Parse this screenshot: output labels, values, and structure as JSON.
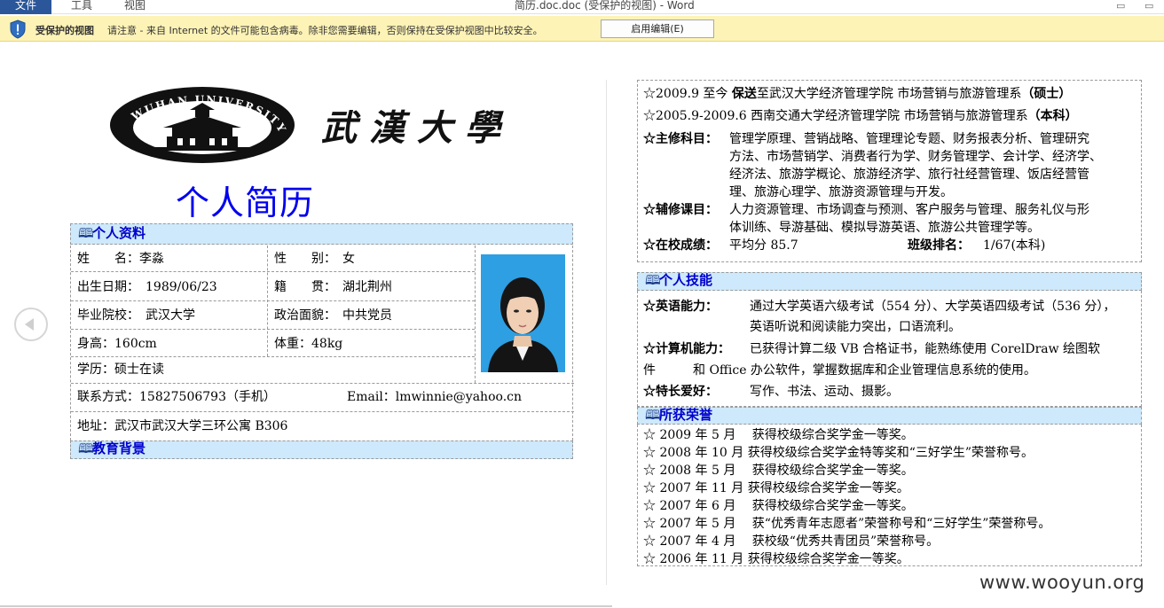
{
  "ribbon": {
    "file_tab": "文件",
    "tools_tab": "工具",
    "view_tab": "视图",
    "window_title": "简历.doc.doc (受保护的视图) - Word"
  },
  "protected_bar": {
    "title": "受保护的视图",
    "message": "请注意 - 来自 Internet 的文件可能包含病毒。除非您需要编辑，否则保持在受保护视图中比较安全。",
    "enable_button": "启用编辑(E)"
  },
  "left_page": {
    "logo_text": "WUHAN UNIVERSITY",
    "calligraphy": "武漢大學",
    "resume_title": "个人简历",
    "personal_section": "个人资料",
    "education_section": "教育背景",
    "info": {
      "name": "姓　　名：李淼",
      "gender": "性　　别：　女",
      "birth": "出生日期：　1989/06/23",
      "native": "籍　　贯：　湖北荆州",
      "school": "毕业院校：　武汉大学",
      "politics": "政治面貌：　中共党员",
      "height": "身高：160cm",
      "weight": "体重：48kg",
      "degree": "学历：硕士在读",
      "contact": "联系方式：15827506793（手机）",
      "email": "Email：lmwinnie@yahoo.cn",
      "address": "地址：武汉市武汉大学三环公寓 B306"
    }
  },
  "right_page": {
    "edu1_prefix": "☆2009.9 至今",
    "edu1_bold": "保送",
    "edu1_rest": "至武汉大学经济管理学院 市场营销与旅游管理系",
    "edu1_degree": "（硕士）",
    "edu2_text": "☆2005.9-2009.6 西南交通大学经济管理学院 市场营销与旅游管理系",
    "edu2_degree": "（本科）",
    "major_label": "☆主修科目：",
    "major_lines": [
      "管理学原理、营销战略、管理理论专题、财务报表分析、管理研究",
      "方法、市场营销学、消费者行为学、财务管理学、会计学、经济学、",
      "经济法、旅游学概论、旅游经济学、旅行社经营管理、饭店经营管",
      "理、旅游心理学、旅游资源管理与开发。"
    ],
    "minor_label": "☆辅修课目：",
    "minor_lines": [
      "人力资源管理、市场调查与预测、客户服务与管理、服务礼仪与形",
      "体训练、导游基础、模拟导游英语、旅游公共管理学等。"
    ],
    "grade_label": "☆在校成绩：",
    "grade_value": "平均分 85.7",
    "rank_label": "班级排名：",
    "rank_value": "1/67(本科)",
    "skills_section": "个人技能",
    "english_label": "☆英语能力：",
    "english_lines": [
      "通过大学英语六级考试（554 分）、大学英语四级考试（536 分），",
      "英语听说和阅读能力突出，口语流利。"
    ],
    "computer_label": "☆计算机能力：",
    "computer_lines": [
      "已获得计算二级 VB 合格证书，能熟练使用 CorelDraw 绘图软",
      "件　　　和 Office 办公软件，掌握数据库和企业管理信息系统的使用。"
    ],
    "hobby_label": "☆特长爱好：",
    "hobby_value": "写作、书法、运动、摄影。",
    "honors_section": "所获荣誉",
    "honors": [
      "☆  2009 年 5 月　 获得校级综合奖学金一等奖。",
      "☆  2008 年 10 月  获得校级综合奖学金特等奖和“三好学生”荣誉称号。",
      "☆  2008 年 5 月　 获得校级综合奖学金一等奖。",
      "☆  2007 年 11 月  获得校级综合奖学金一等奖。",
      "☆  2007 年 6 月　 获得校级综合奖学金一等奖。",
      "☆  2007 年 5 月　 获“优秀青年志愿者”荣誉称号和“三好学生”荣誉称号。",
      "☆  2007 年 4 月　 获校级“优秀共青团员”荣誉称号。",
      "☆  2006 年 11 月  获得校级综合奖学金一等奖。"
    ]
  },
  "watermark": "www.wooyun.org"
}
